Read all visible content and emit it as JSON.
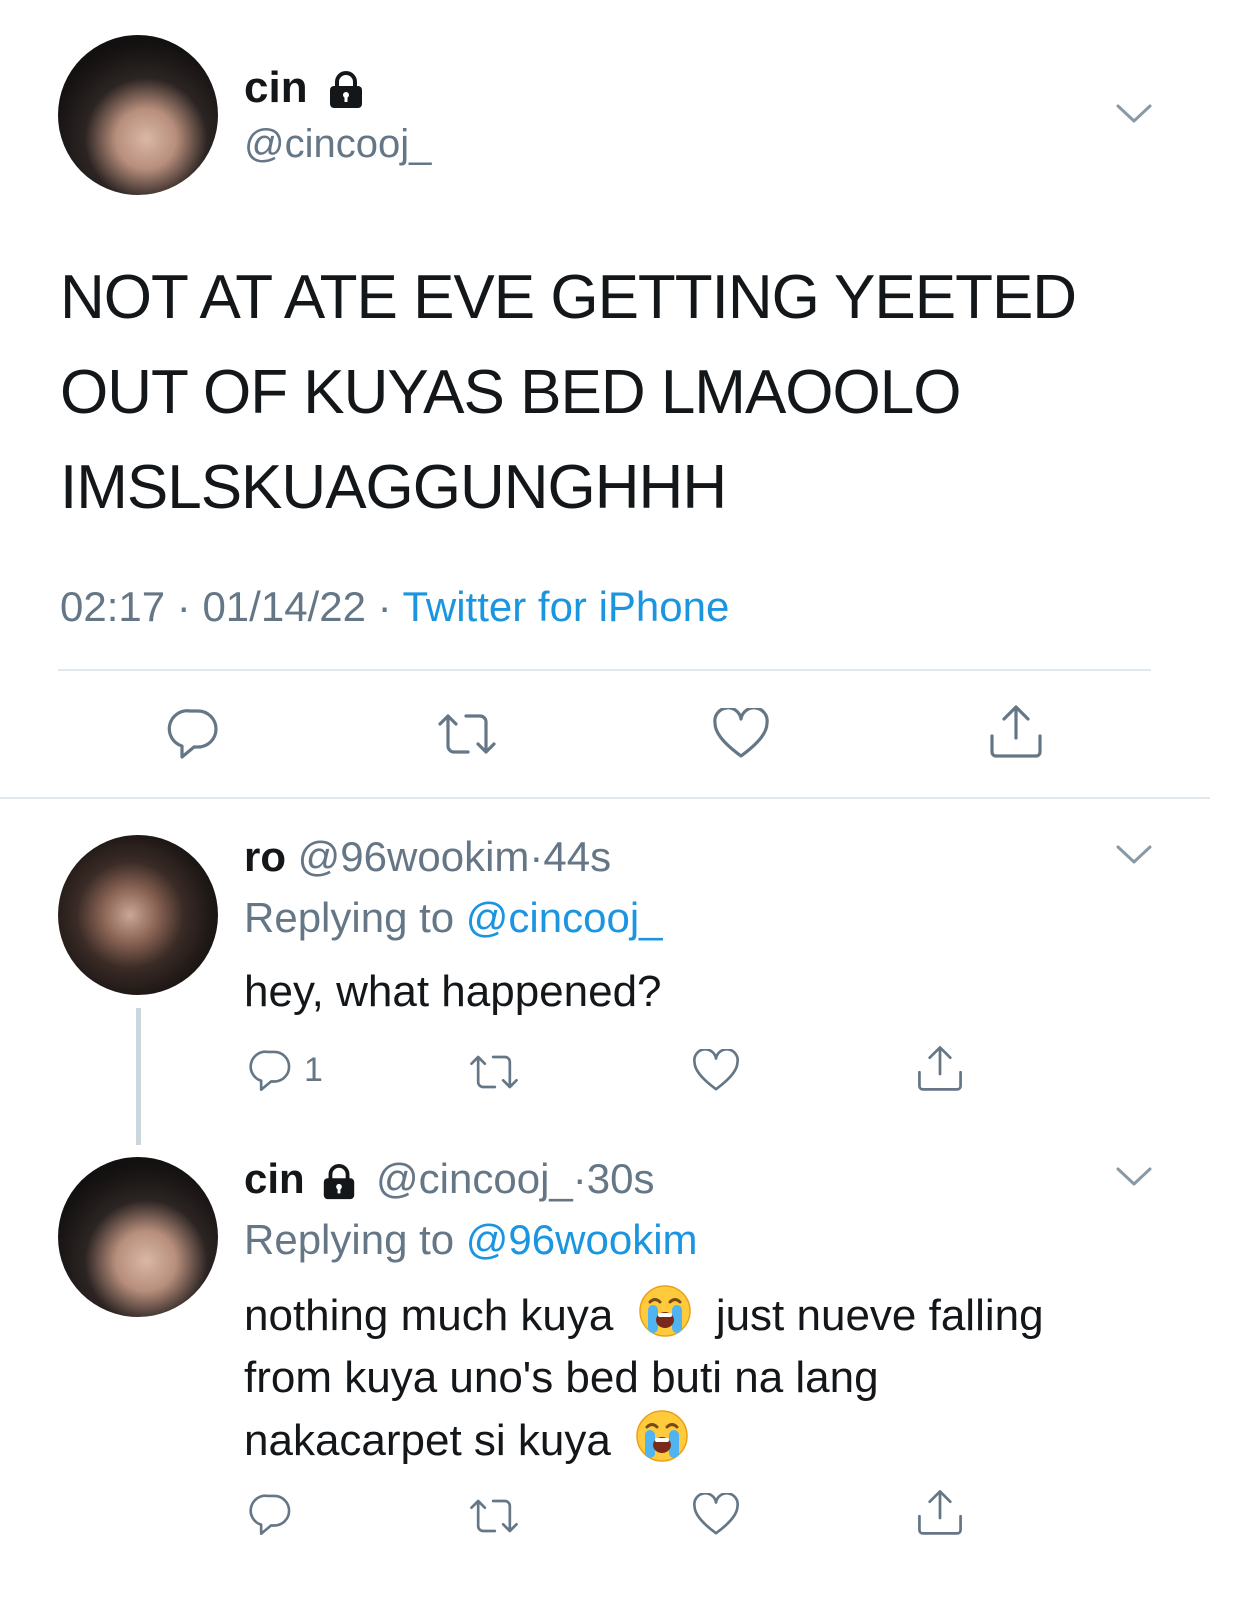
{
  "main_tweet": {
    "display_name": "cin",
    "handle": "@cincooj_",
    "text_lines": [
      "NOT AT ATE EVE GETTING YEETED",
      "OUT OF KUYAS BED LMAOOLO",
      "IMSLSKUAGGUNGHHH"
    ],
    "time": "02:17",
    "date": "01/14/22",
    "source": "Twitter for iPhone",
    "sep": "·"
  },
  "reply1": {
    "display_name": "ro",
    "handle": "@96wookim",
    "age": "44s",
    "replying_prefix": "Replying to",
    "replying_to": "@cincooj_",
    "text": "hey, what happened?",
    "reply_count": "1"
  },
  "reply2": {
    "display_name": "cin",
    "handle": "@cincooj_",
    "age": "30s",
    "replying_prefix": "Replying to",
    "replying_to": "@96wookim",
    "line1_a": "nothing much kuya",
    "line1_b": "just nueve falling",
    "line2": "from kuya uno's bed buti na lang",
    "line3": "nakacarpet si kuya"
  },
  "colors": {
    "link": "#1b95e0",
    "muted": "#657786",
    "divider": "#e1e8ed"
  }
}
